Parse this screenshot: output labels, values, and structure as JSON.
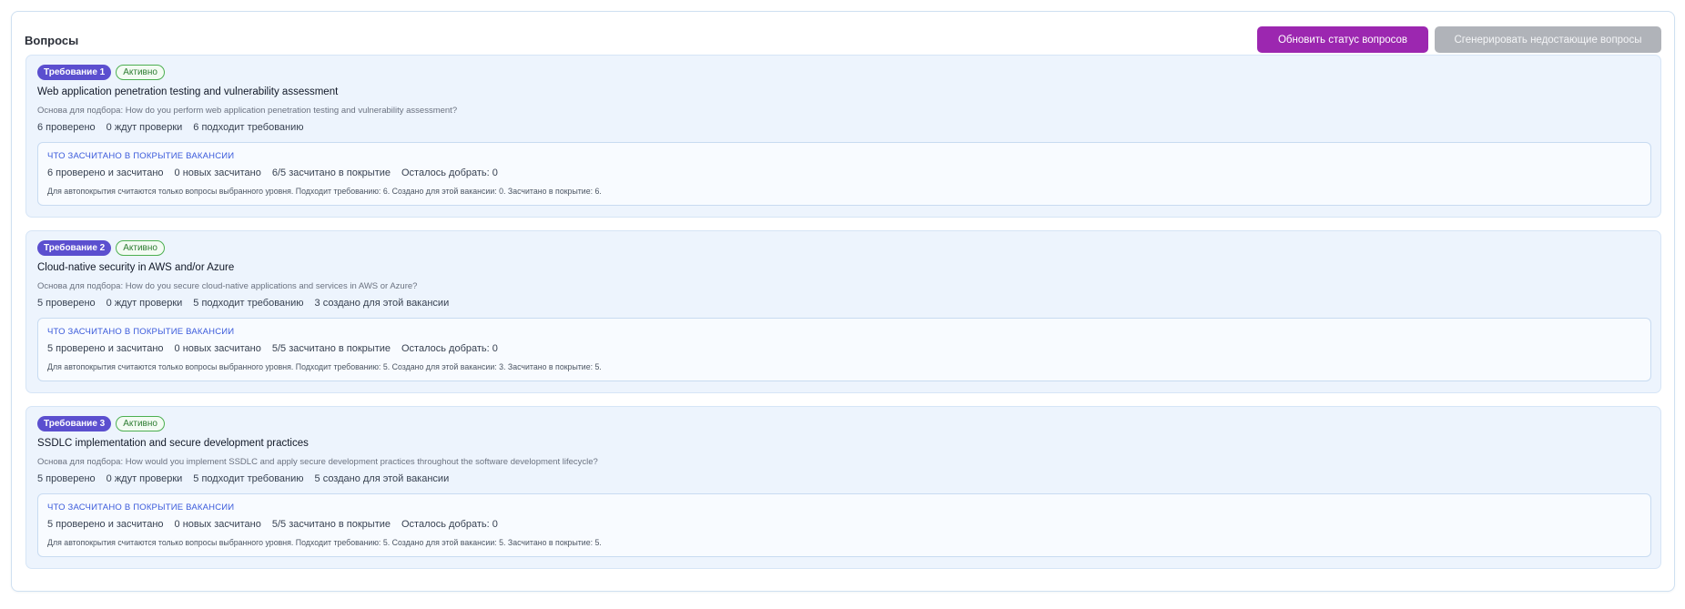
{
  "panel": {
    "title": "Вопросы",
    "refresh_button": "Обновить статус вопросов",
    "generate_button": "Сгенерировать недостающие вопросы"
  },
  "requirements": [
    {
      "badge": "Требование 1",
      "status": "Активно",
      "title": "Web application penetration testing and vulnerability assessment",
      "basis": "Основа для подбора: How do you perform web application penetration testing and vulnerability assessment?",
      "stats": [
        "6 проверено",
        "0 ждут проверки",
        "6 подходит требованию",
        ""
      ],
      "coverage_heading": "ЧТО ЗАСЧИТАНО В ПОКРЫТИЕ ВАКАНСИИ",
      "coverage_stats": [
        "6 проверено и засчитано",
        "0 новых засчитано",
        "6/5 засчитано в покрытие",
        "Осталось добрать: 0"
      ],
      "coverage_note": "Для автопокрытия считаются только вопросы выбранного уровня. Подходит требованию: 6. Создано для этой вакансии: 0. Засчитано в покрытие: 6."
    },
    {
      "badge": "Требование 2",
      "status": "Активно",
      "title": "Cloud-native security in AWS and/or Azure",
      "basis": "Основа для подбора: How do you secure cloud-native applications and services in AWS or Azure?",
      "stats": [
        "5 проверено",
        "0 ждут проверки",
        "5 подходит требованию",
        "3 создано для этой вакансии"
      ],
      "coverage_heading": "ЧТО ЗАСЧИТАНО В ПОКРЫТИЕ ВАКАНСИИ",
      "coverage_stats": [
        "5 проверено и засчитано",
        "0 новых засчитано",
        "5/5 засчитано в покрытие",
        "Осталось добрать: 0"
      ],
      "coverage_note": "Для автопокрытия считаются только вопросы выбранного уровня. Подходит требованию: 5. Создано для этой вакансии: 3. Засчитано в покрытие: 5."
    },
    {
      "badge": "Требование 3",
      "status": "Активно",
      "title": "SSDLC implementation and secure development practices",
      "basis": "Основа для подбора: How would you implement SSDLC and apply secure development practices throughout the software development lifecycle?",
      "stats": [
        "5 проверено",
        "0 ждут проверки",
        "5 подходит требованию",
        "5 создано для этой вакансии"
      ],
      "coverage_heading": "ЧТО ЗАСЧИТАНО В ПОКРЫТИЕ ВАКАНСИИ",
      "coverage_stats": [
        "5 проверено и засчитано",
        "0 новых засчитано",
        "5/5 засчитано в покрытие",
        "Осталось добрать: 0"
      ],
      "coverage_note": "Для автопокрытия считаются только вопросы выбранного уровня. Подходит требованию: 5. Создано для этой вакансии: 5. Засчитано в покрытие: 5."
    }
  ],
  "colors": {
    "primary_button": "#9c27b0",
    "requirement_badge": "#5b4fcf",
    "active_status": "#2e7d32",
    "coverage_heading": "#3b5bdb"
  }
}
